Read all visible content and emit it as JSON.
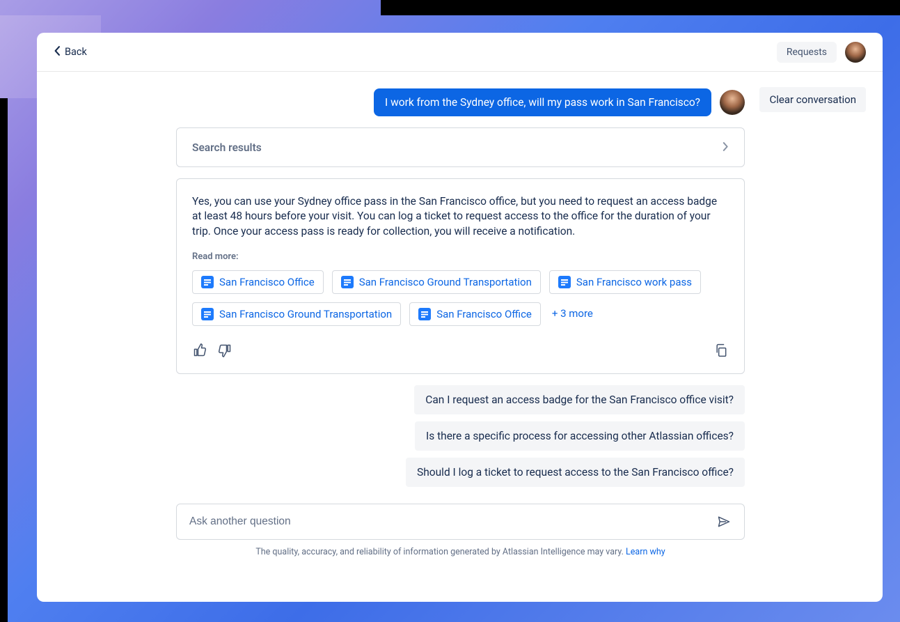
{
  "header": {
    "back_label": "Back",
    "requests_label": "Requests"
  },
  "clear_label": "Clear conversation",
  "user_message": "I work from the Sydney office, will my pass work in San Francisco?",
  "search_results_label": "Search results",
  "answer": "Yes, you can use your Sydney office pass in the San Francisco office, but you need to request an access badge at least 48 hours before your visit. You can log a ticket to request access to the office for the duration of your trip. Once your access pass is ready for collection, you will receive a notification.",
  "read_more_label": "Read more:",
  "sources": [
    {
      "label": "San Francisco Office"
    },
    {
      "label": "San Francisco Ground Transportation"
    },
    {
      "label": "San Francisco work pass"
    },
    {
      "label": "San Francisco Ground Transportation"
    },
    {
      "label": "San Francisco Office"
    }
  ],
  "more_label": "+ 3 more",
  "suggestions": [
    "Can I request an access badge for the San Francisco office visit?",
    "Is there a specific process for accessing other Atlassian offices?",
    "Should I log a ticket to request access to the San Francisco office?"
  ],
  "input_placeholder": "Ask another question",
  "disclaimer_text": "The quality, accuracy, and reliability of information generated by Atlassian Intelligence may vary. ",
  "disclaimer_link": "Learn why"
}
